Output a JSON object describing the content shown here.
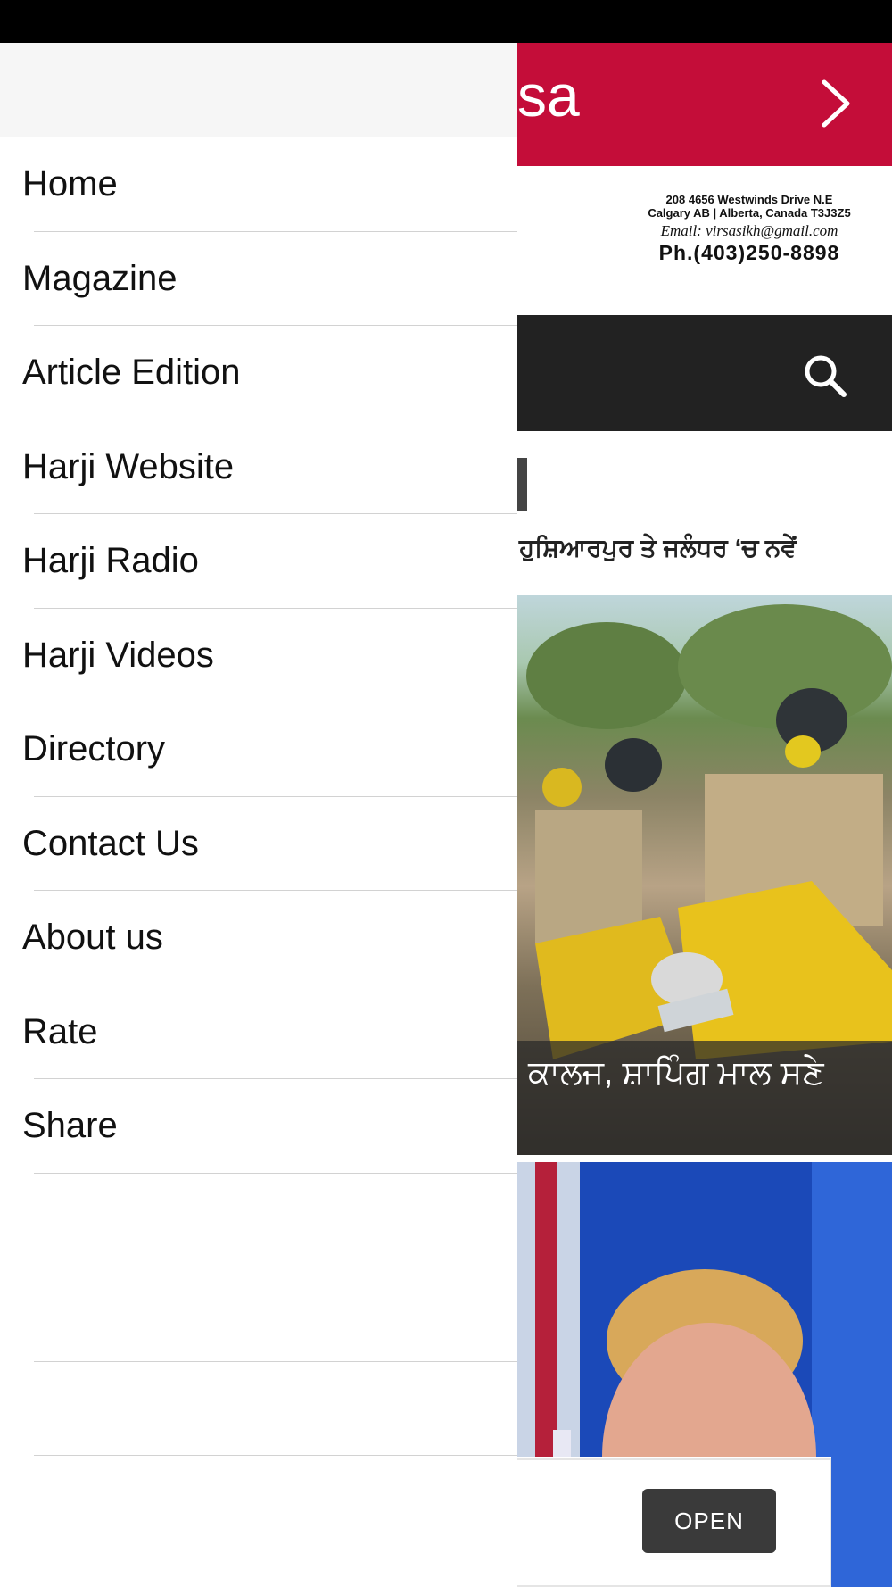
{
  "app": {
    "title_fragment": "sa",
    "address": {
      "line1": "208 4656 Westwinds Drive N.E",
      "line2": "Calgary AB | Alberta, Canada T3J3Z5",
      "email": "Email: virsasikh@gmail.com",
      "phone": "Ph.(403)250-8898"
    },
    "headline1": "ਹੁਸ਼ਿਆਰਪੁਰ ਤੇ ਜਲੰਧਰ ‘ਚ ਨਵੇਂ",
    "caption1": "ਕਾਲਜ, ਸ਼ਾਪਿੰਗ ਮਾਲ ਸਣੇ",
    "ad": {
      "open_label": "OPEN"
    },
    "colors": {
      "header": "#c40d39",
      "search_bar": "#222222"
    }
  },
  "drawer": {
    "items": [
      {
        "label": "Home"
      },
      {
        "label": "Magazine"
      },
      {
        "label": "Article Edition"
      },
      {
        "label": "Harji Website"
      },
      {
        "label": "Harji Radio"
      },
      {
        "label": "Harji Videos"
      },
      {
        "label": "Directory"
      },
      {
        "label": "Contact Us"
      },
      {
        "label": "About us"
      },
      {
        "label": "Rate"
      },
      {
        "label": "Share"
      },
      {
        "label": ""
      },
      {
        "label": ""
      },
      {
        "label": ""
      },
      {
        "label": ""
      }
    ]
  }
}
